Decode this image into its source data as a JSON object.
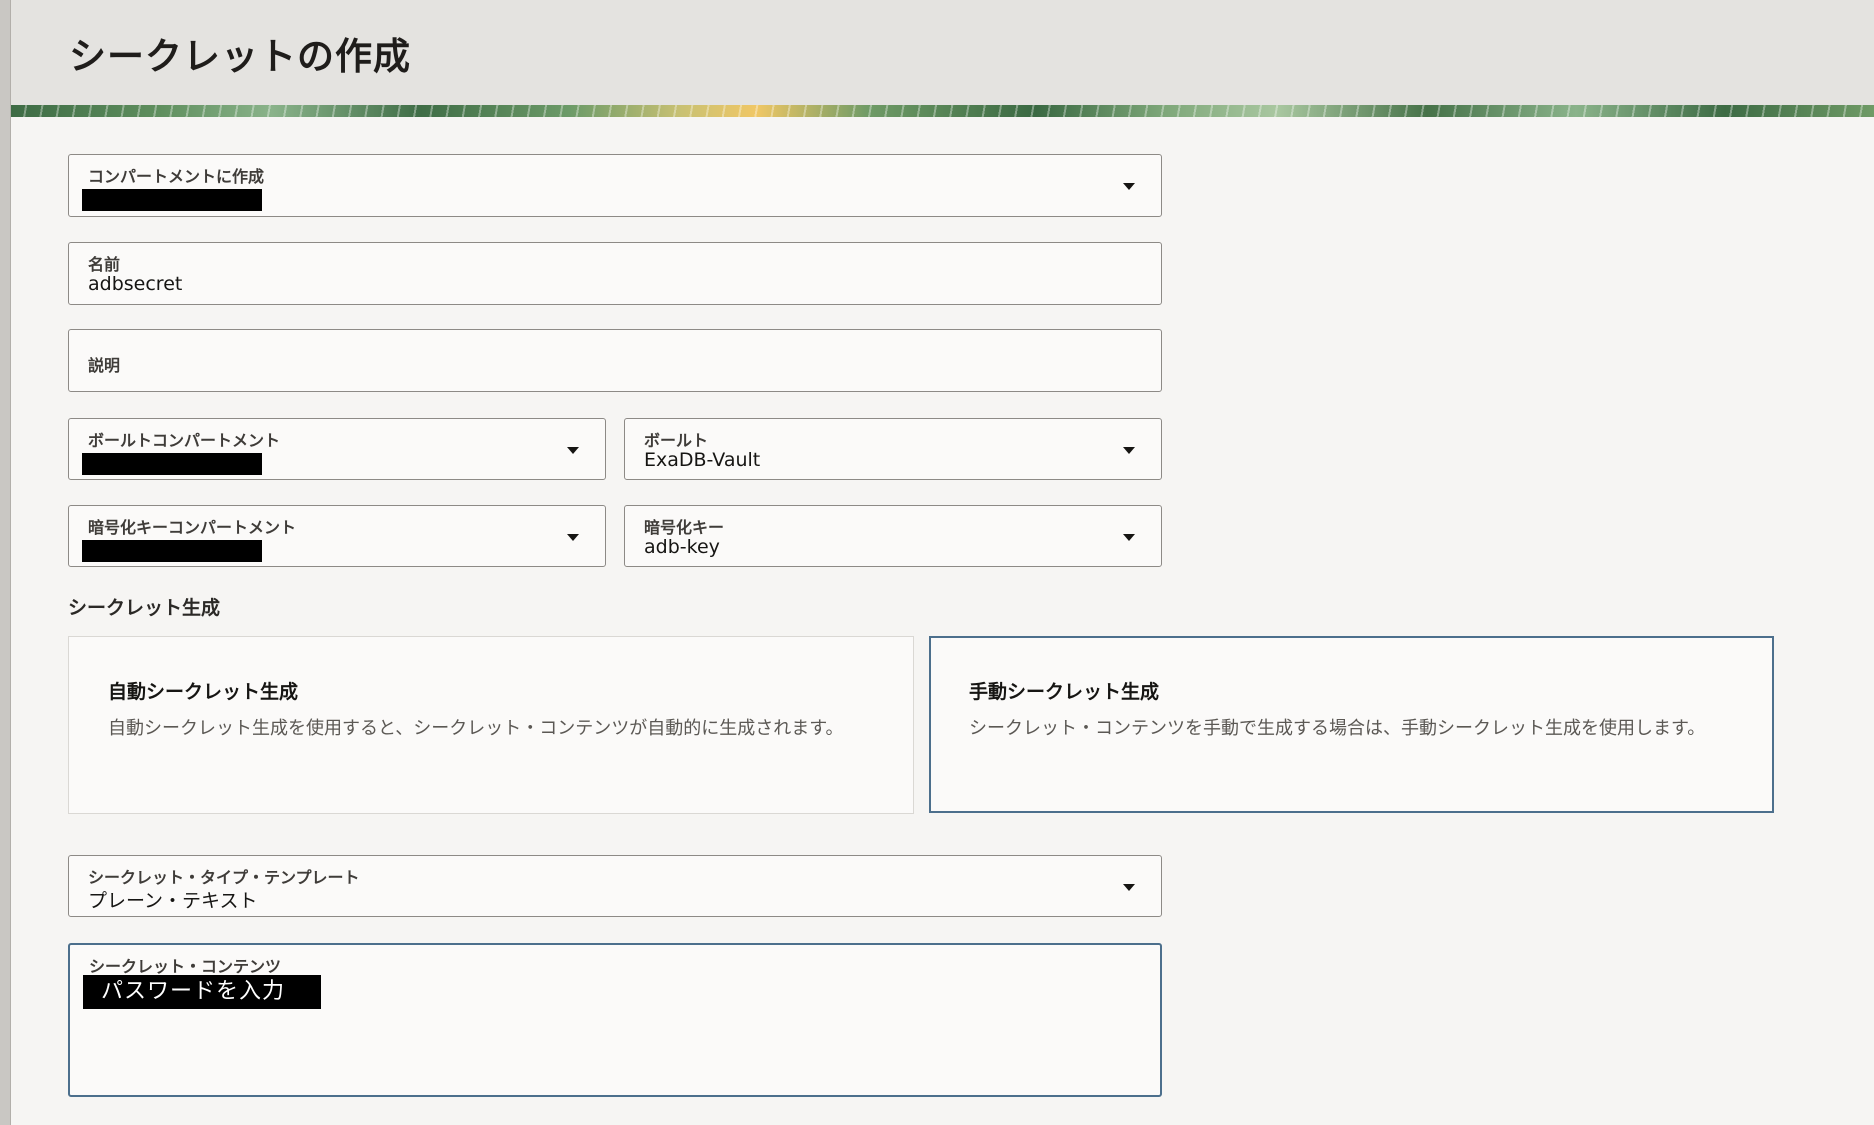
{
  "page": {
    "title": "シークレットの作成"
  },
  "form": {
    "compartment": {
      "label": "コンパートメントに作成"
    },
    "name": {
      "label": "名前",
      "value": "adbsecret"
    },
    "description": {
      "label": "説明"
    },
    "vault_compartment": {
      "label": "ボールトコンパートメント"
    },
    "vault": {
      "label": "ボールト",
      "value": "ExaDB-Vault"
    },
    "key_compartment": {
      "label": "暗号化キーコンパートメント"
    },
    "key": {
      "label": "暗号化キー",
      "value": "adb-key"
    },
    "generation_section": "シークレット生成",
    "auto_card": {
      "title": "自動シークレット生成",
      "description": "自動シークレット生成を使用すると、シークレット・コンテンツが自動的に生成されます。"
    },
    "manual_card": {
      "title": "手動シークレット生成",
      "description": "シークレット・コンテンツを手動で生成する場合は、手動シークレット生成を使用します。"
    },
    "type_template": {
      "label": "シークレット・タイプ・テンプレート",
      "value": "プレーン・テキスト"
    },
    "contents": {
      "label": "シークレット・コンテンツ",
      "value": "パスワードを入力"
    }
  }
}
